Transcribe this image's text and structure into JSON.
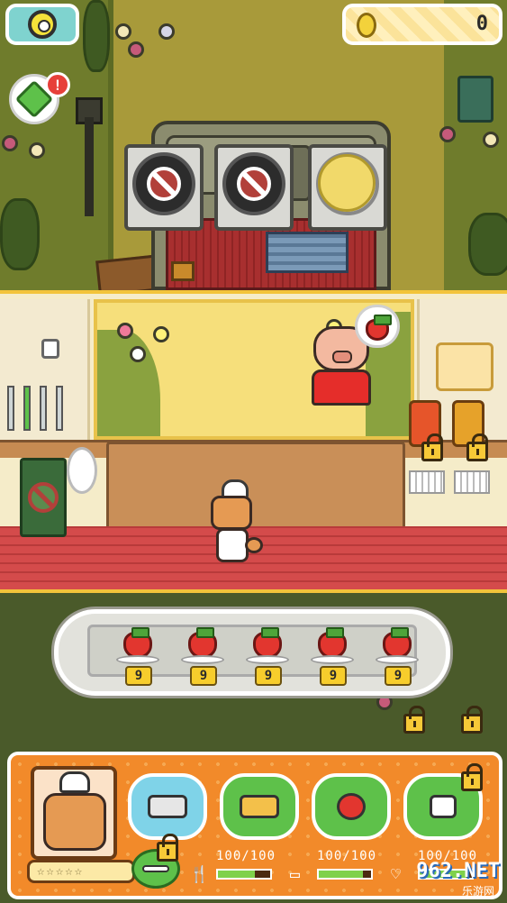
{
  "hud": {
    "settings_icon": "gear-icon",
    "coin_value": "0",
    "coin_icon": "coin-icon",
    "gem_icon": "gem-icon",
    "gem_badge": "!"
  },
  "kitchen": {
    "stoves": [
      {
        "state": "blocked",
        "icon": "no-entry-icon"
      },
      {
        "state": "blocked",
        "icon": "no-entry-icon"
      },
      {
        "state": "cooking",
        "icon": "pancake-icon"
      }
    ],
    "customer_order_icon": "strawberry-icon"
  },
  "tray": {
    "items": [
      {
        "icon": "strawberry-icon",
        "count": "9"
      },
      {
        "icon": "strawberry-icon",
        "count": "9"
      },
      {
        "icon": "strawberry-icon",
        "count": "9"
      },
      {
        "icon": "strawberry-icon",
        "count": "9"
      },
      {
        "icon": "strawberry-icon",
        "count": "9"
      }
    ]
  },
  "bottom": {
    "tools": [
      {
        "name": "whisk",
        "icon": "whisk-icon",
        "color": "#7fd3e8"
      },
      {
        "name": "pancake",
        "icon": "pancake-icon",
        "color": "#5ec14a"
      },
      {
        "name": "fruit",
        "icon": "fruit-icon",
        "color": "#5ec14a"
      },
      {
        "name": "utensils",
        "icon": "utensils-icon",
        "color": "#5ec14a"
      }
    ],
    "stars": "☆☆☆☆☆",
    "stats": [
      {
        "icon": "fork-knife-icon",
        "label": "100/100",
        "fill": 0.7
      },
      {
        "icon": "bed-icon",
        "label": "100/100",
        "fill": 0.85
      },
      {
        "icon": "heart-icon",
        "label": "100/100",
        "fill": 0.9
      }
    ]
  },
  "watermark": {
    "main": "962.NET",
    "sub": "乐游网"
  },
  "colors": {
    "accent_orange": "#f28a2a",
    "tray": "#e2e2dc",
    "lock": "#f7c937"
  }
}
